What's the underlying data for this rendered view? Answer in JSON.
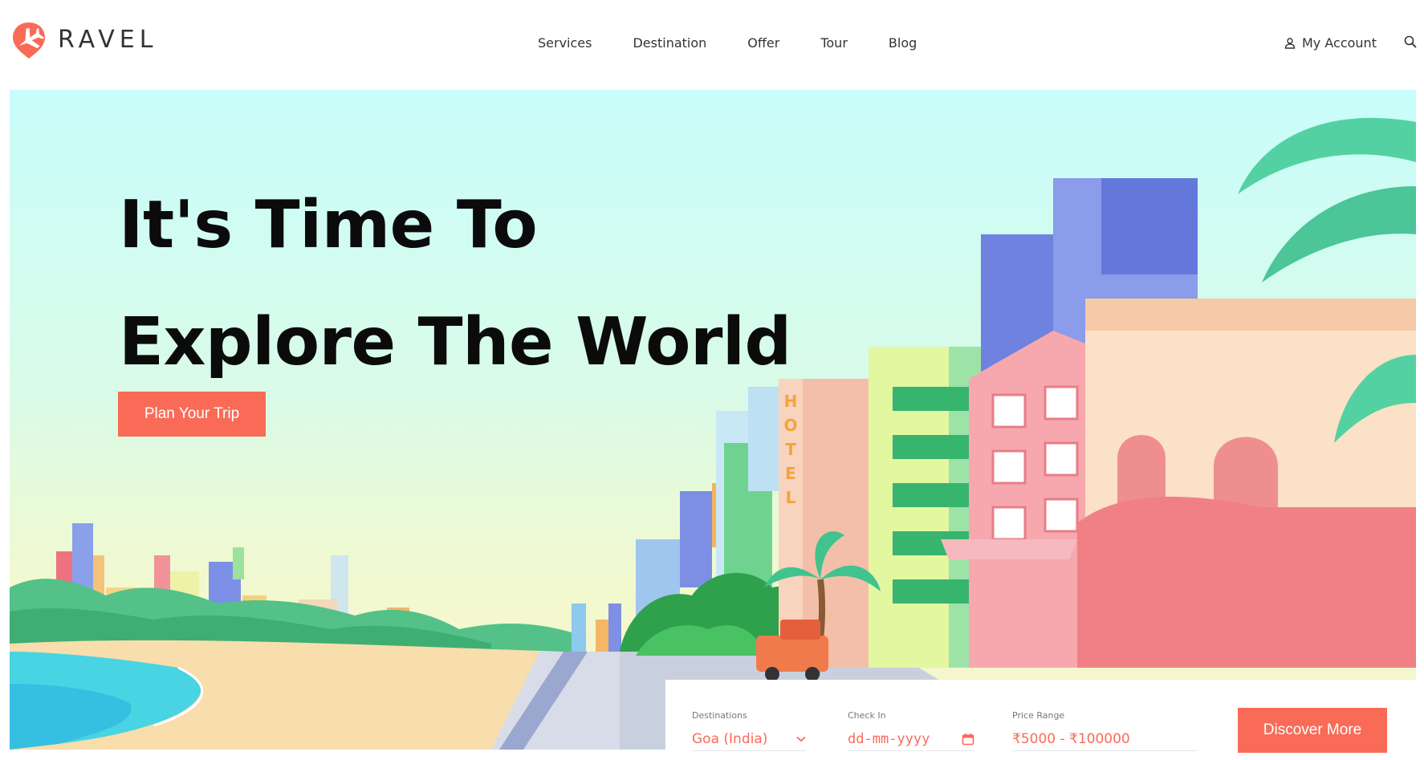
{
  "brand": {
    "name": "RAVEL",
    "accent": "#f96b57"
  },
  "nav": {
    "items": [
      {
        "label": "Services"
      },
      {
        "label": "Destination"
      },
      {
        "label": "Offer"
      },
      {
        "label": "Tour"
      },
      {
        "label": "Blog"
      }
    ]
  },
  "account": {
    "label": "My Account",
    "icon": "user-icon"
  },
  "search": {
    "icon": "search-icon"
  },
  "hero": {
    "title_line1": "It's Time To",
    "title_line2": "Explore The World",
    "cta_label": "Plan Your Trip",
    "hotel_sign": "HOTEL"
  },
  "booking": {
    "destination": {
      "label": "Destinations",
      "value": "Goa (India)"
    },
    "checkin": {
      "label": "Check In",
      "placeholder": "dd-mm-yyyy"
    },
    "price": {
      "label": "Price Range",
      "value": "₹5000 - ₹100000"
    },
    "submit_label": "Discover More"
  }
}
